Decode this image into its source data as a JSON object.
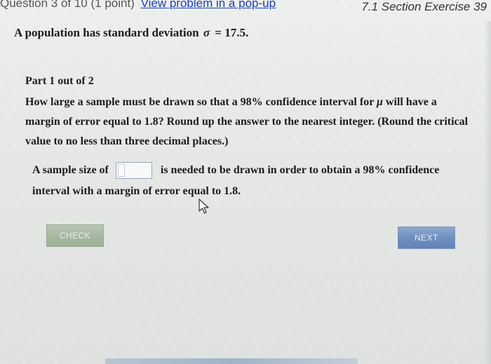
{
  "header": {
    "question_info": "Question 3 of 10 (1 point)",
    "popup_link": "View problem in a pop-up",
    "section": "7.1 Section Exercise 39"
  },
  "problem": {
    "intro_prefix": "A population has standard deviation",
    "sigma_symbol": "σ",
    "intro_value": "= 17.5.",
    "part": "Part 1 out of 2",
    "question_part1": "How large a sample must be drawn so that a 98% confidence interval for",
    "mu_symbol": "μ",
    "question_part2": "will have a margin of error equal to 1.8? Round up the answer to the nearest integer. (Round the critical value to no less than three decimal places.)",
    "answer_prefix": "A sample size of",
    "answer_suffix": "is needed to be drawn in order to obtain a 98% confidence interval with a margin of error equal to 1.8.",
    "answer_value": ""
  },
  "buttons": {
    "check": "CHECK",
    "next": "NEXT"
  }
}
